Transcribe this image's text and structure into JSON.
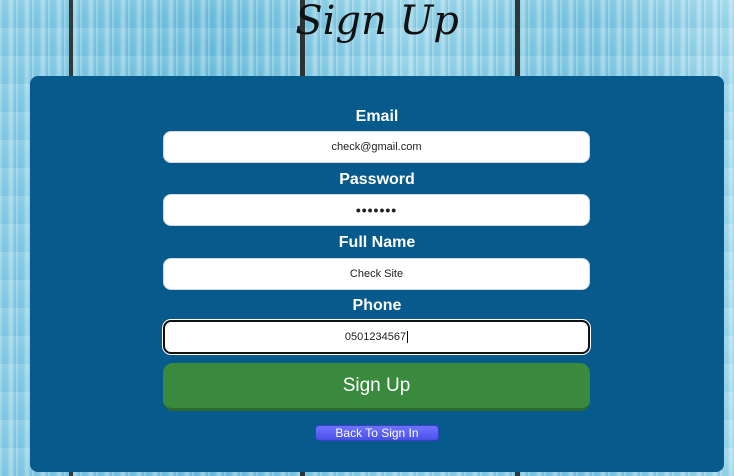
{
  "header": {
    "title": "Sign Up"
  },
  "form": {
    "email": {
      "label": "Email",
      "value": "check@gmail.com"
    },
    "password": {
      "label": "Password",
      "value": "•••••••"
    },
    "full_name": {
      "label": "Full Name",
      "value": "Check Site"
    },
    "phone": {
      "label": "Phone",
      "value": "0501234567"
    },
    "submit_label": "Sign Up",
    "back_label": "Back To Sign In"
  },
  "colors": {
    "card": "#075a8c",
    "submit": "#3a8a3e",
    "back": "#5a5ff0"
  }
}
